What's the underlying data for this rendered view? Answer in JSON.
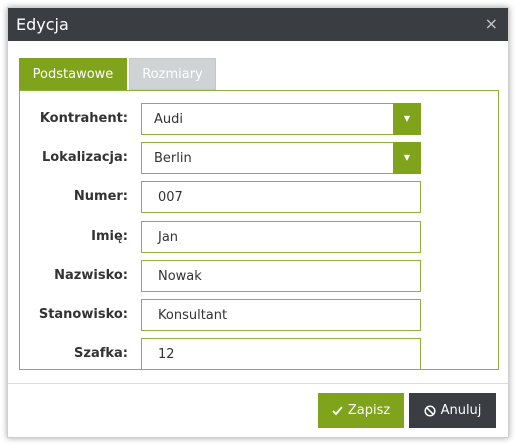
{
  "dialog": {
    "title": "Edycja",
    "close_glyph": "×"
  },
  "tabs": [
    {
      "label": "Podstawowe",
      "active": true
    },
    {
      "label": "Rozmiary",
      "active": false
    }
  ],
  "form": {
    "kontrahent": {
      "label": "Kontrahent:",
      "value": "Audi"
    },
    "lokalizacja": {
      "label": "Lokalizacja:",
      "value": "Berlin"
    },
    "numer": {
      "label": "Numer:",
      "value": "007"
    },
    "imie": {
      "label": "Imię:",
      "value": "Jan"
    },
    "nazwisko": {
      "label": "Nazwisko:",
      "value": "Nowak"
    },
    "stanowisko": {
      "label": "Stanowisko:",
      "value": "Konsultant"
    },
    "szafka": {
      "label": "Szafka:",
      "value": "12"
    }
  },
  "dropdown_arrow": "▼",
  "buttons": {
    "save_label": "Zapisz",
    "cancel_label": "Anuluj"
  },
  "colors": {
    "accent": "#7fa31a",
    "titlebar": "#3a3d42",
    "inactive_tab": "#cfd3d6",
    "border": "#8bb23a"
  },
  "icons": {
    "save": "check-icon",
    "cancel": "ban-icon",
    "close": "close-icon",
    "dropdown": "caret-down-icon"
  }
}
